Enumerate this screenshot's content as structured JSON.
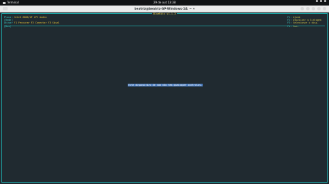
{
  "topbar": {
    "app_label": "Terminal",
    "clock": "29 de out 13:38",
    "icons": [
      "network-icon",
      "volume-icon",
      "power-icon"
    ]
  },
  "window": {
    "title": "beatriz@beatriz-GP-Windows-14: ~",
    "title_chevron": "▾"
  },
  "app": {
    "title": "BlueRitz v1.1.3"
  },
  "info": {
    "lines": [
      {
        "key": "Placa:",
        "value": "Intel 8086/AF LPC Audio"
      },
      {
        "key": "[Rede]",
        "value": ""
      },
      {
        "key": "  Ativar",
        "value": "F1 Procurar  F2 Conectar  F3 Sinal"
      },
      {
        "key": "[Dev]",
        "value": ""
      }
    ]
  },
  "menu": {
    "items": [
      {
        "key": "F1",
        "label": "Ajuda"
      },
      {
        "key": "F2",
        "label": "Atualizar a listagem"
      },
      {
        "key": "F3",
        "label": "Selecionar o disp."
      },
      {
        "key": "F4",
        "label": "Sair"
      }
    ]
  },
  "status": {
    "message": "Este dispositivo de som não tem quaisquer controlos."
  },
  "colors": {
    "background": "#202a30",
    "border": "#1fa6a6",
    "text_cyan": "#3fd4cf",
    "text_yellow": "#f2e24c",
    "highlight": "#4d7ec0"
  }
}
